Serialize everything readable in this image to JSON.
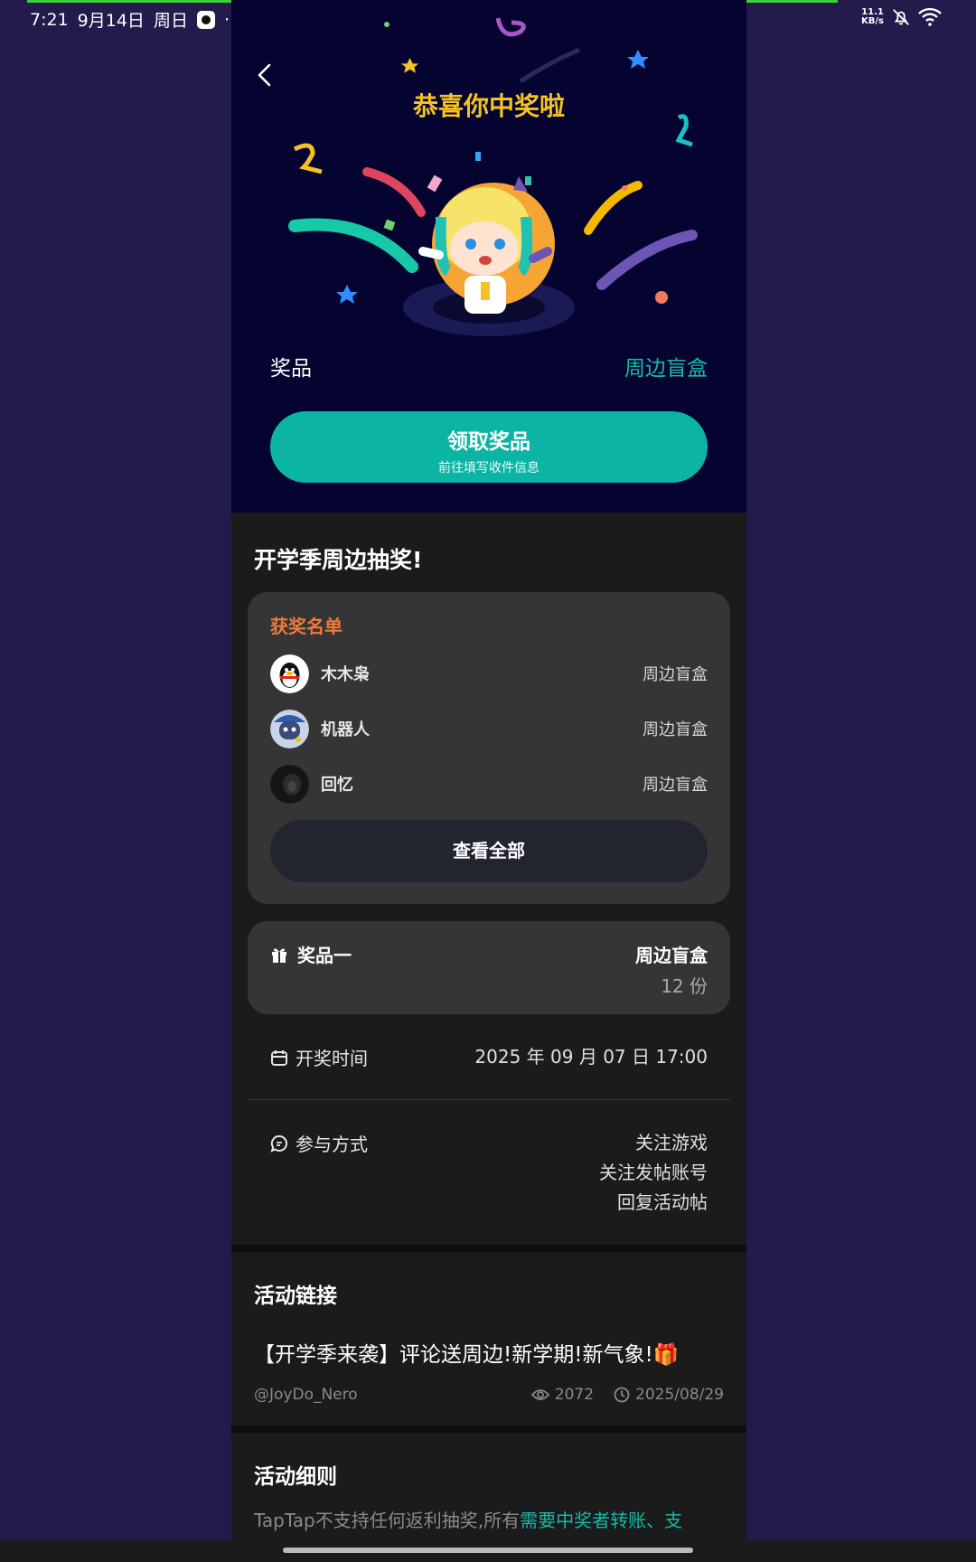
{
  "status_bar": {
    "time": "7:21",
    "date": "9月14日",
    "weekday": "周日",
    "more": "···",
    "net_speed_value": "11.1",
    "net_speed_unit": "KB/s",
    "icons": [
      "app-icon",
      "mute-bell-icon",
      "wifi-icon"
    ],
    "progress_color": "#3fcf3a"
  },
  "hero": {
    "title": "恭喜你中奖啦",
    "prize_label": "奖品",
    "prize_value": "周边盲盒",
    "claim_button": {
      "title": "领取奖品",
      "subtitle": "前往填写收件信息"
    },
    "colors": {
      "title": "#f5c223",
      "accent": "#19b8a8",
      "button": "#0cb4a4",
      "background": "#050330"
    }
  },
  "activity_title": "开学季周边抽奖!",
  "winners": {
    "title": "获奖名单",
    "rows": [
      {
        "name": "木木枭",
        "prize": "周边盲盒",
        "avatar": "qq-penguin-avatar"
      },
      {
        "name": "机器人",
        "prize": "周边盲盒",
        "avatar": "robot-avatar"
      },
      {
        "name": "回忆",
        "prize": "周边盲盒",
        "avatar": "dark-photo-avatar"
      }
    ],
    "view_all": "查看全部"
  },
  "prize_card": {
    "label": "奖品一",
    "value": "周边盲盒",
    "count": "12 份",
    "icon": "gift-icon"
  },
  "draw_time": {
    "label": "开奖时间",
    "value": "2025 年 09 月 07 日 17:00",
    "icon": "calendar-icon"
  },
  "participation": {
    "label": "参与方式",
    "icon": "chat-icon",
    "methods": [
      "关注游戏",
      "关注发帖账号",
      "回复活动帖"
    ]
  },
  "activity_link": {
    "section_title": "活动链接",
    "post_title": "【开学季来袭】评论送周边!新学期!新气象!🎁",
    "author": "@JoyDo_Nero",
    "views": "2072",
    "date": "2025/08/29"
  },
  "rules": {
    "section_title": "活动细则",
    "text_plain": "TapTap不支持任何返利抽奖,所有",
    "text_highlight": "需要中奖者转账、支"
  }
}
